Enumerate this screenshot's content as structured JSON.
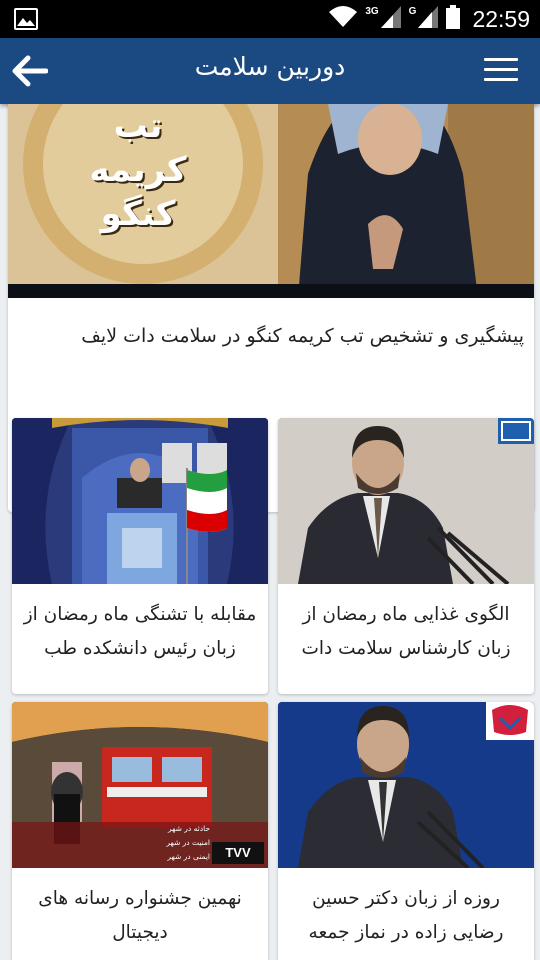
{
  "status_bar": {
    "time": "22:59",
    "network_1": "3G",
    "network_2": "G"
  },
  "app_bar": {
    "title": "دوربین سلامت"
  },
  "featured": {
    "image_text_line1": "تب",
    "image_text_line2": "کریمه",
    "image_text_line3": "کنگو",
    "caption": "پیشگیری و تشخیص تب کریمه کنگو در سلامت دات لایف"
  },
  "articles": [
    {
      "caption": "الگوی غذایی ماه رمضان از زبان کارشناس سلامت دات"
    },
    {
      "caption": "مقابله با تشنگی ماه رمضان از زبان رئیس دانشکده طب"
    },
    {
      "caption": "روزه از زبان دکتر حسین رضایی زاده در نماز جمعه"
    },
    {
      "caption": "نهمین جشنواره رسانه های دیجیتال",
      "overlay_line1": "حادثه در شهر",
      "overlay_line2": "امنیت در شهر",
      "overlay_line3": "ایمنی در شهر",
      "channel_logo": "TVV"
    }
  ]
}
